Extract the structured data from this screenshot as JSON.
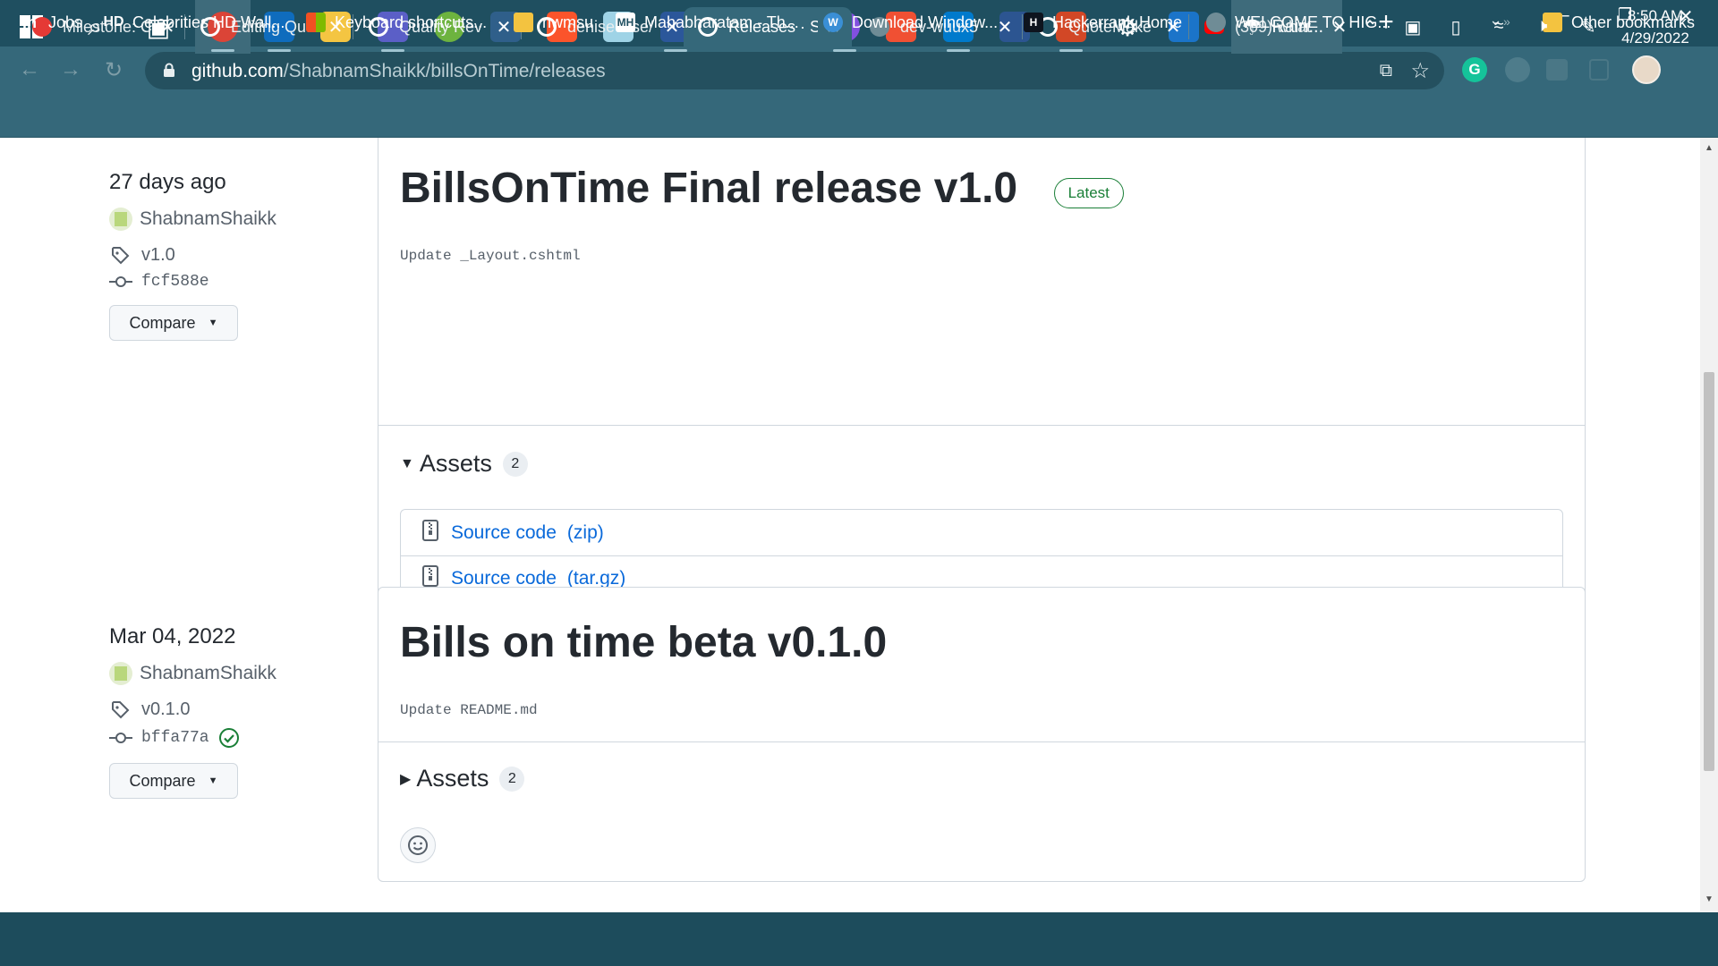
{
  "browser": {
    "tabs": [
      {
        "title": "Milestone: C",
        "icon": "milestone-icon",
        "color": "#e53935"
      },
      {
        "title": "Editing Qua",
        "icon": "github-icon",
        "color": "#ffffff"
      },
      {
        "title": "Quality Rev",
        "icon": "github-icon",
        "color": "#ffffff"
      },
      {
        "title": "denisecase/",
        "icon": "github-icon",
        "color": "#ffffff"
      },
      {
        "title": "Releases · S",
        "icon": "github-icon",
        "color": "#ffffff"
      },
      {
        "title": "dev-wuux5",
        "icon": "globe-icon",
        "color": "#6f8c96"
      },
      {
        "title": "QuoteMake",
        "icon": "github-icon",
        "color": "#ffffff"
      },
      {
        "title": "(309) what",
        "icon": "youtube-icon",
        "color": "#ff0000"
      }
    ],
    "new_tab": "+",
    "url_host": "github.com",
    "url_path": "/ShabnamShaikk/billsOnTime/releases"
  },
  "bookmarks": [
    {
      "label": "Jobs",
      "icon": "linkedin-icon",
      "color": "#0a66c2",
      "glyph": "in"
    },
    {
      "label": "Celebrities HD Wall...",
      "icon": "hd-icon",
      "color": "#222222",
      "glyph": "HD"
    },
    {
      "label": "Keyboard shortcuts...",
      "icon": "microsoft-icon",
      "color": "#f25022",
      "glyph": ""
    },
    {
      "label": "nwmsu",
      "icon": "folder-icon",
      "color": "#f3c340",
      "glyph": ""
    },
    {
      "label": "Mahabharatam - Th...",
      "icon": "mahabharatam-icon",
      "color": "#ffffff",
      "glyph": "MH"
    },
    {
      "label": "Download Window...",
      "icon": "wordpress-icon",
      "color": "#3a8fd6",
      "glyph": "W"
    },
    {
      "label": "Hackerrank Home",
      "icon": "hackerrank-icon",
      "color": "#0e141e",
      "glyph": "H"
    },
    {
      "label": "WELCOME TO HIG...",
      "icon": "globe-icon",
      "color": "#6f8c96",
      "glyph": ""
    }
  ],
  "other_bookmarks": "Other bookmarks",
  "releases": [
    {
      "date": "27 days ago",
      "author": "ShabnamShaikk",
      "tag": "v1.0",
      "commit": "fcf588e",
      "verified": false,
      "compare_label": "Compare",
      "title": "BillsOnTime Final release v1.0",
      "badge": "Latest",
      "body": "Update _Layout.cshtml",
      "assets_label": "Assets",
      "assets_count": "2",
      "assets_expanded": true,
      "assets": [
        {
          "name": "Source code",
          "ext": "(zip)"
        },
        {
          "name": "Source code",
          "ext": "(tar.gz)"
        }
      ]
    },
    {
      "date": "Mar 04, 2022",
      "author": "ShabnamShaikk",
      "tag": "v0.1.0",
      "commit": "bffa77a",
      "verified": true,
      "compare_label": "Compare",
      "title": "Bills on time beta v0.1.0",
      "badge": "",
      "body": "Update README.md",
      "assets_label": "Assets",
      "assets_count": "2",
      "assets_expanded": false,
      "assets": []
    }
  ],
  "taskbar": {
    "apps": [
      "windows-start-icon",
      "search-icon",
      "task-view-icon",
      "chrome-icon",
      "outlook-icon",
      "file-explorer-icon",
      "teams-icon",
      "spring-tool-icon",
      "mysql-workbench-icon",
      "brave-icon",
      "notepad-icon",
      "word-icon",
      "edge-icon",
      "mongodb-compass-icon",
      "github-desktop-icon",
      "git-icon",
      "vscode-icon",
      "powershell-icon",
      "powerpoint-icon",
      "settings-icon",
      "movies-tv-icon"
    ],
    "weather": "Rain...",
    "time": "8:50 AM",
    "date": "4/29/2022"
  }
}
